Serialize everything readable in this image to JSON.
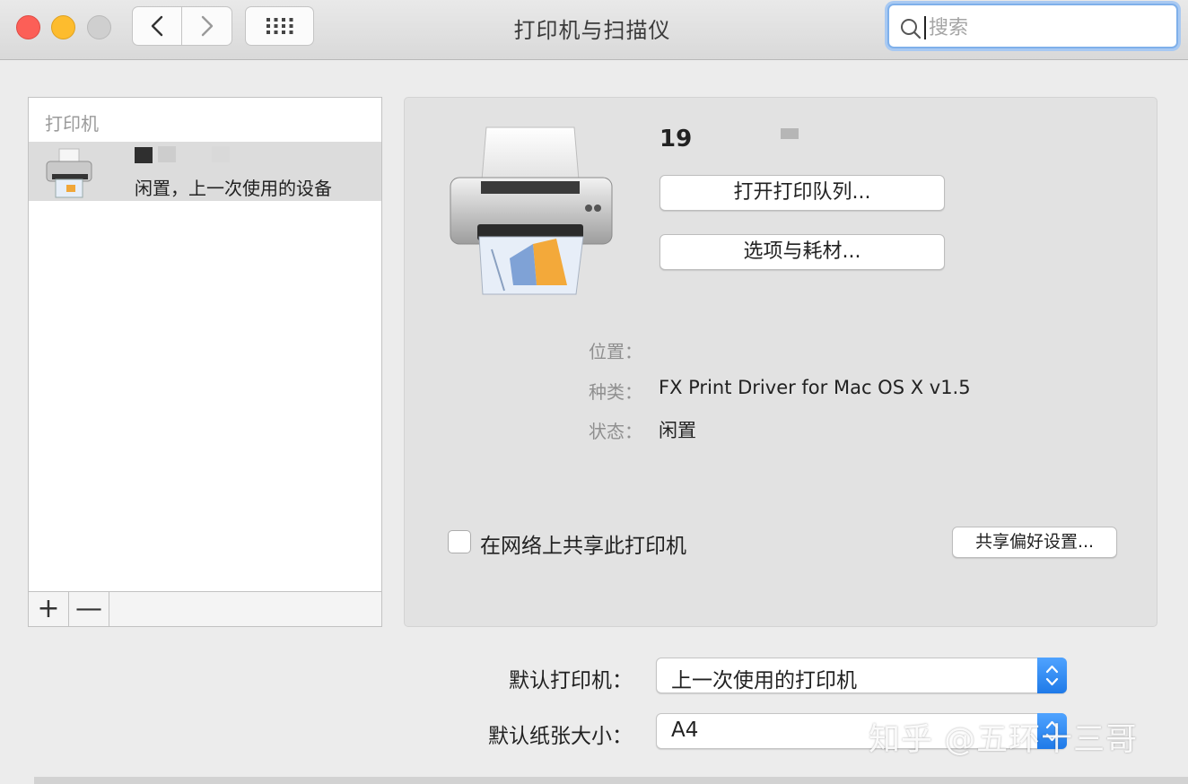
{
  "window": {
    "title": "打印机与扫描仪"
  },
  "search": {
    "placeholder": "搜索"
  },
  "printer_list": {
    "header": "打印机",
    "items": [
      {
        "name": "",
        "status": "闲置，上一次使用的设备"
      }
    ]
  },
  "list_toolbar": {
    "add_label": "+",
    "remove_label": "—"
  },
  "detail": {
    "printer_name": "19",
    "open_queue_button": "打开打印队列...",
    "options_button": "选项与耗材...",
    "location_label": "位置：",
    "location_value": "",
    "kind_label": "种类：",
    "kind_value": "FX Print Driver for Mac OS X v1.5",
    "status_label": "状态：",
    "status_value": "闲置",
    "share_checkbox_label": "在网络上共享此打印机",
    "share_checked": false,
    "share_prefs_button": "共享偏好设置..."
  },
  "defaults": {
    "default_printer_label": "默认打印机：",
    "default_printer_value": "上一次使用的打印机",
    "default_paper_label": "默认纸张大小：",
    "default_paper_value": "A4"
  },
  "watermark": "知乎 @五环十三哥",
  "colors": {
    "close": "#fc5f57",
    "minimize": "#fdbc2e",
    "zoom_disabled": "#cfcfcf",
    "accent": "#1f7ae8",
    "search_focus": "#7fb0ea"
  },
  "icons": [
    "chevron-left-icon",
    "chevron-right-icon",
    "grid-icon",
    "magnifier-icon",
    "printer-icon",
    "stepper-icon"
  ]
}
